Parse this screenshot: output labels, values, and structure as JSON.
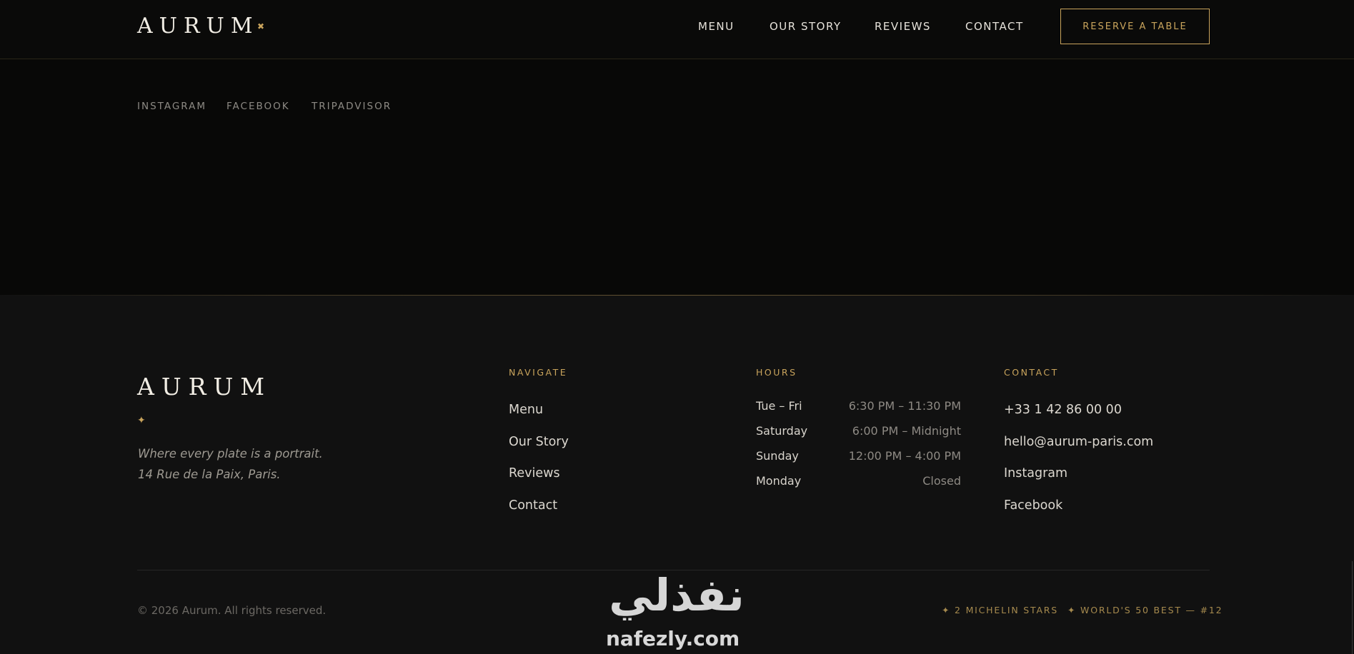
{
  "header": {
    "logo": "AURUM",
    "logo_mark": "✖",
    "nav": [
      "MENU",
      "OUR STORY",
      "REVIEWS",
      "CONTACT"
    ],
    "reserve_label": "RESERVE A TABLE"
  },
  "social": [
    "INSTAGRAM",
    "FACEBOOK",
    "TRIPADVISOR"
  ],
  "footer": {
    "logo": "AURUM",
    "star": "✦",
    "tagline_1": "Where every plate is a portrait.",
    "tagline_2": "14 Rue de la Paix, Paris.",
    "navigate": {
      "heading": "NAVIGATE",
      "links": [
        "Menu",
        "Our Story",
        "Reviews",
        "Contact"
      ]
    },
    "hours": {
      "heading": "HOURS",
      "rows": [
        {
          "day": "Tue – Fri",
          "time": "6:30 PM – 11:30 PM"
        },
        {
          "day": "Saturday",
          "time": "6:00 PM – Midnight"
        },
        {
          "day": "Sunday",
          "time": "12:00 PM – 4:00 PM"
        },
        {
          "day": "Monday",
          "time": "Closed"
        }
      ]
    },
    "contact": {
      "heading": "CONTACT",
      "phone": "+33 1 42 86 00 00",
      "email": "hello@aurum-paris.com",
      "links": [
        "Instagram",
        "Facebook"
      ]
    },
    "copyright": "© 2026 Aurum. All rights reserved.",
    "badges": [
      "✦ 2 MICHELIN STARS",
      "✦ WORLD'S 50 BEST — #12"
    ]
  },
  "watermark": {
    "arabic": "نفذلي",
    "latin": "nafezly.com"
  },
  "colors": {
    "gold": "#c9a45c",
    "background": "#080807",
    "footer_bg": "#111111"
  }
}
